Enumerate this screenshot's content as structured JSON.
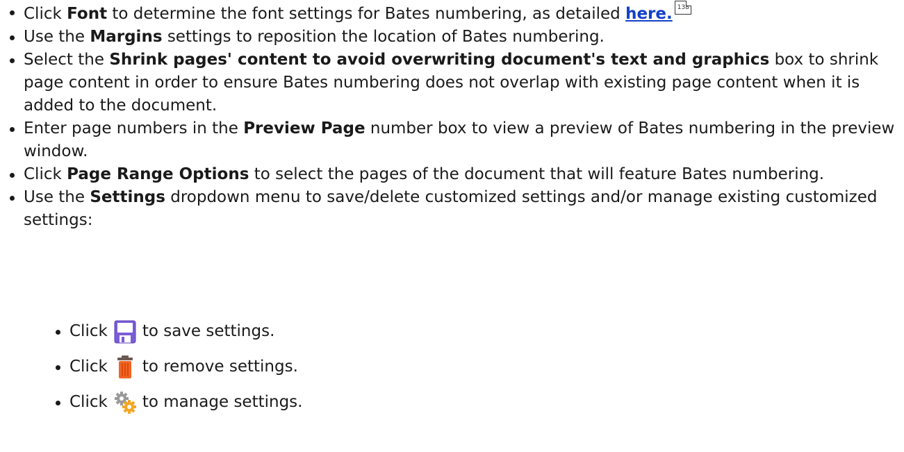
{
  "bullets": [
    {
      "t1": "Click ",
      "b1": "Font",
      "t2": " to determine the font settings for Bates numbering, as detailed ",
      "link": "here.",
      "page_ref": "138"
    },
    {
      "t1": "Use the ",
      "b1": "Margins",
      "t2": " settings to reposition the location of Bates numbering."
    },
    {
      "t1": "Select the ",
      "b1": "Shrink pages' content to avoid overwriting document's text and graphics",
      "t2": " box to shrink page content in order to ensure Bates numbering does not overlap with existing page content when it is added to the document."
    },
    {
      "t1": "Enter page numbers in the ",
      "b1": "Preview Page",
      "t2": " number box to view a preview of Bates numbering in the preview window."
    },
    {
      "t1": "Click ",
      "b1": "Page Range Options",
      "t2": " to select the pages of the document that will feature Bates numbering."
    },
    {
      "t1": "Use the ",
      "b1": "Settings",
      "t2": " dropdown menu to save/delete customized settings and/or manage existing customized settings:"
    }
  ],
  "sub_bullets": [
    {
      "before": "Click",
      "icon": "floppy-disk-save-icon",
      "after": "to save settings."
    },
    {
      "before": "Click",
      "icon": "trash-can-icon",
      "after": "to remove settings."
    },
    {
      "before": "Click",
      "icon": "gears-manage-icon",
      "after": "to manage settings."
    }
  ],
  "colors": {
    "link": "#1240c8",
    "save_icon": "#7b5cd6",
    "trash_icon": "#f26522",
    "gear_icon": "#f5a623"
  }
}
